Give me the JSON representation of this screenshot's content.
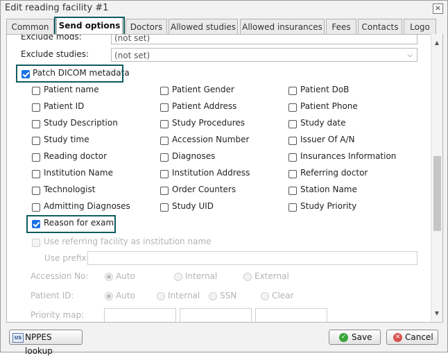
{
  "window": {
    "title": "Edit reading facility #1",
    "close_glyph": "×"
  },
  "tabs": [
    {
      "label": "Common"
    },
    {
      "label": "Send options"
    },
    {
      "label": "Doctors"
    },
    {
      "label": "Allowed studies"
    },
    {
      "label": "Allowed insurances"
    },
    {
      "label": "Fees"
    },
    {
      "label": "Contacts"
    },
    {
      "label": "Logo"
    }
  ],
  "active_tab": "Send options",
  "form": {
    "exclude_mods": {
      "label": "Exclude mods:",
      "value": "(not set)"
    },
    "exclude_studies": {
      "label": "Exclude studies:",
      "value": "(not set)"
    },
    "patch_dicom": {
      "label": "Patch DICOM metadata",
      "checked": true
    },
    "fields": [
      {
        "label": "Patient name",
        "checked": false
      },
      {
        "label": "Patient Gender",
        "checked": false
      },
      {
        "label": "Patient DoB",
        "checked": false
      },
      {
        "label": "Patient ID",
        "checked": false
      },
      {
        "label": "Patient Address",
        "checked": false
      },
      {
        "label": "Patient Phone",
        "checked": false
      },
      {
        "label": "Study Description",
        "checked": false
      },
      {
        "label": "Study Procedures",
        "checked": false
      },
      {
        "label": "Study date",
        "checked": false
      },
      {
        "label": "Study time",
        "checked": false
      },
      {
        "label": "Accession Number",
        "checked": false
      },
      {
        "label": "Issuer Of A/N",
        "checked": false
      },
      {
        "label": "Reading doctor",
        "checked": false
      },
      {
        "label": "Diagnoses",
        "checked": false
      },
      {
        "label": "Insurances Information",
        "checked": false
      },
      {
        "label": "Institution Name",
        "checked": false
      },
      {
        "label": "Institution Address",
        "checked": false
      },
      {
        "label": "Referring doctor",
        "checked": false
      },
      {
        "label": "Technologist",
        "checked": false
      },
      {
        "label": "Order Counters",
        "checked": false
      },
      {
        "label": "Station Name",
        "checked": false
      },
      {
        "label": "Admitting Diagnoses",
        "checked": false
      },
      {
        "label": "Study UID",
        "checked": false
      },
      {
        "label": "Study Priority",
        "checked": false
      }
    ],
    "reason_for_exam": {
      "label": "Reason for exam",
      "checked": true
    },
    "use_referring": {
      "label": "Use referring facility as institution name",
      "checked": false
    },
    "use_prefix": {
      "label": "Use prefix:",
      "value": ""
    },
    "accession_no": {
      "label": "Accession No:",
      "options": [
        "Auto",
        "Internal",
        "External"
      ],
      "selected": "Auto"
    },
    "patient_id": {
      "label": "Patient ID:",
      "options": [
        "Auto",
        "Internal",
        "SSN",
        "Clear"
      ],
      "selected": "Auto"
    },
    "priority_map": {
      "label": "Priority map:"
    }
  },
  "footer": {
    "nppes_label": "NPPES lookup",
    "save_label": "Save",
    "cancel_label": "Cancel"
  },
  "colors": {
    "highlight": "#0d5c5e",
    "checkbox_checked": "#1a73e8",
    "save_icon": "#3aa53a",
    "cancel_icon": "#d9534f"
  }
}
